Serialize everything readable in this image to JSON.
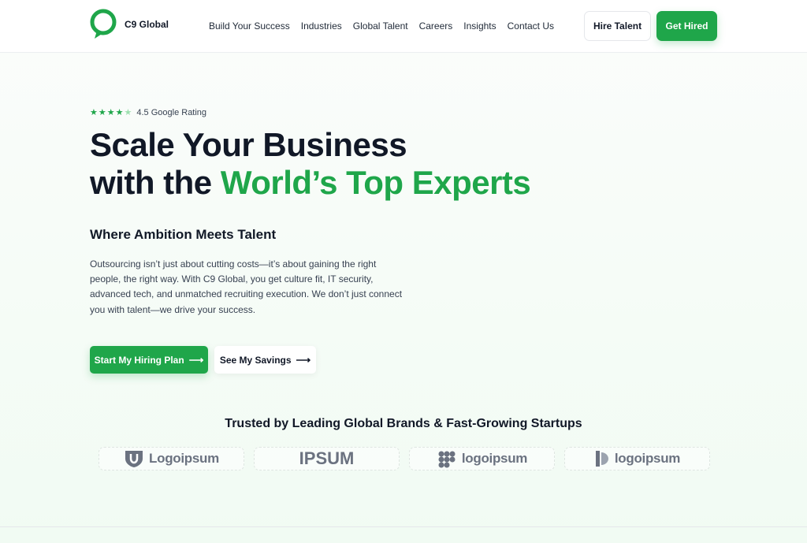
{
  "colors": {
    "accent": "#1fa64a",
    "text": "#111827"
  },
  "header": {
    "brand": "C9 Global",
    "nav": [
      {
        "label": "Build Your Success"
      },
      {
        "label": "Industries"
      },
      {
        "label": "Global Talent"
      },
      {
        "label": "Careers"
      },
      {
        "label": "Insights"
      },
      {
        "label": "Contact Us"
      }
    ],
    "hire_label": "Hire Talent",
    "get_hired_label": "Get Hired"
  },
  "hero": {
    "rating": {
      "stars": 4.5,
      "text": "4.5 Google Rating"
    },
    "title_line1": "Scale Your Business",
    "title_line2_prefix": "with the ",
    "title_line2_accent": "World’s Top Experts",
    "subtitle": "Where Ambition Meets Talent",
    "description": "Outsourcing isn’t just about cutting costs—it’s about gaining the right people, the right way. With C9 Global, you get culture fit, IT security, advanced tech, and unmatched recruiting execution. We don’t just connect you with talent—we drive your success.",
    "primary_cta": "Start My Hiring Plan",
    "secondary_cta": "See My Savings",
    "arrow": "⟶"
  },
  "trusted": {
    "heading": "Trusted by Leading Global Brands & Fast-Growing Startups",
    "brands": [
      {
        "name": "Logoipsum",
        "icon": "shield-logo-icon"
      },
      {
        "name": "IPSUM",
        "icon": "none"
      },
      {
        "name": "logoipsum",
        "icon": "dots-logo-icon"
      },
      {
        "name": "logoipsum",
        "icon": "half-circle-logo-icon"
      }
    ]
  }
}
